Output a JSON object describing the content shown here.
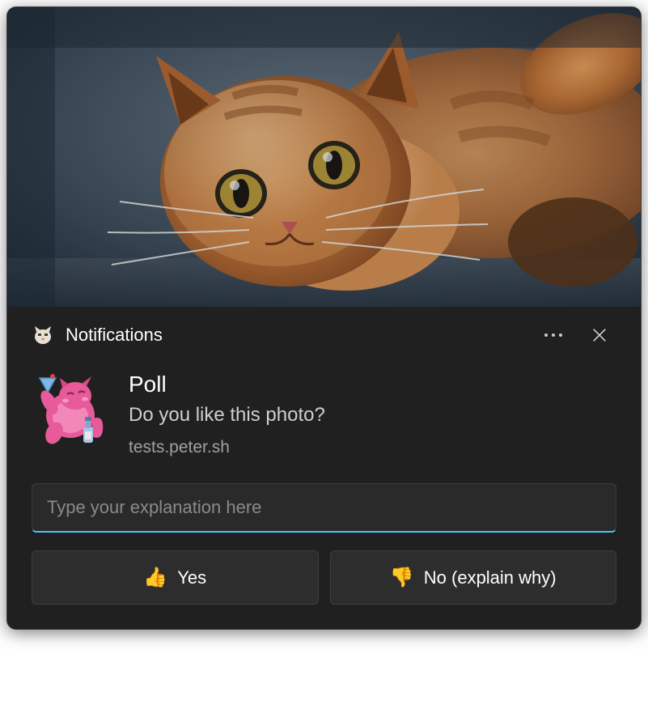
{
  "header": {
    "app_name": "Notifications"
  },
  "content": {
    "title": "Poll",
    "body": "Do you like this photo?",
    "source": "tests.peter.sh"
  },
  "input": {
    "placeholder": "Type your explanation here",
    "value": ""
  },
  "actions": {
    "yes": {
      "emoji": "👍",
      "label": "Yes"
    },
    "no": {
      "emoji": "👎",
      "label": "No (explain why)"
    }
  }
}
